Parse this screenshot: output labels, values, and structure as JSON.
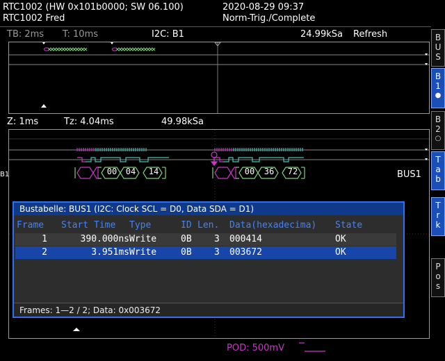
{
  "header": {
    "device_line1": "RTC1002 (HW 0x101b0000; SW 06.100)",
    "device_line2": "RTC1002 Fred",
    "datetime": "2020-08-29 09:37",
    "trigger_status": "Norm-Trig./Complete"
  },
  "overview": {
    "timebase": "TB: 2ms",
    "trigger_time": "T: 10ms",
    "bus_label": "I2C: B1",
    "sample_rate": "24.99kSa",
    "mode": "Refresh"
  },
  "zoom": {
    "zoom_label": "Z: 1ms",
    "zoom_time": "Tz: 4.04ms",
    "sample_rate": "49.98kSa",
    "left_marker": "B1",
    "bus_name": "BUS1",
    "frame1_bytes": [
      "00",
      "04",
      "14"
    ],
    "frame2_bytes": [
      "00",
      "36",
      "72"
    ]
  },
  "sidebar": [
    {
      "letters": [
        "B",
        "U",
        "S"
      ],
      "active": false
    },
    {
      "letters": [
        "B",
        "1"
      ],
      "active": true
    },
    {
      "letters": [
        "B",
        "2"
      ],
      "active": false
    },
    {
      "letters": [
        "T",
        "a",
        "b"
      ],
      "active": true
    },
    {
      "letters": [
        "T",
        "r",
        "k"
      ],
      "active": true
    },
    {
      "letters": [
        "P",
        "o",
        "s"
      ],
      "active": false
    }
  ],
  "table": {
    "title": "Bustabelle: BUS1 (I2C: Clock SCL = D0, Data SDA = D1)",
    "columns": [
      "Frame",
      "Start Time",
      "Type",
      "ID",
      "Len.",
      "Data(hexadecima)",
      "State"
    ],
    "rows": [
      {
        "frame": "1",
        "start": "390.000ns",
        "type": "Write",
        "id": "0B",
        "len": "3",
        "data": "000414",
        "state": "OK"
      },
      {
        "frame": "2",
        "start": "3.951ms",
        "type": "Write",
        "id": "0B",
        "len": "3",
        "data": "003672",
        "state": "OK"
      }
    ],
    "selected_row": 1,
    "footer": "Frames: 1—2 / 2; Data: 0x003672"
  },
  "status_bar": {
    "pod": "POD: 500mV"
  },
  "colors": {
    "accent": "#2f6ff0",
    "magenta": "#c837c8",
    "cyan": "#3fc5b8",
    "green": "#7ed27e",
    "header_blue": "#3f84ff"
  }
}
